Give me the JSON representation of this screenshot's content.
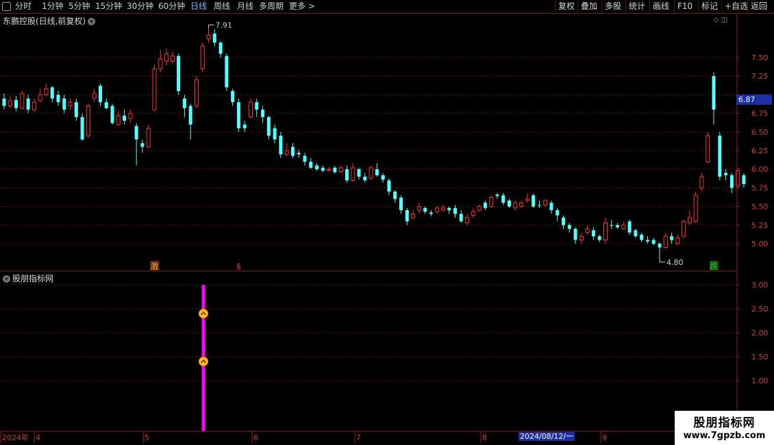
{
  "toolbar": {
    "periods": [
      "分时",
      "1分钟",
      "5分钟",
      "15分钟",
      "30分钟",
      "60分钟",
      "日线",
      "周线",
      "月线",
      "多周期",
      "更多 >"
    ],
    "active_period": "日线",
    "buttons": [
      "复权",
      "叠加",
      "多股",
      "统计",
      "画线",
      "F10",
      "标记",
      "+自选",
      "返回"
    ]
  },
  "main_chart": {
    "title": "东鹏控股(日线,前复权)",
    "current_price_label": "6.87",
    "high_marker": "7.91",
    "low_marker": "4.80",
    "signal_labels": [
      {
        "text": "激",
        "color": "#f0a030"
      },
      {
        "text": "$",
        "color": "#e03030"
      },
      {
        "text": "跌",
        "color": "#30c030"
      }
    ]
  },
  "indicator": {
    "title": "股朋指标网"
  },
  "date_axis": {
    "labels": [
      "2024年",
      "4",
      "5",
      "6",
      "7",
      "8",
      "9"
    ],
    "cursor_date": "2024/08/12/一"
  },
  "watermark": {
    "title": "股朋指标网",
    "url": "www.7gpzb.com"
  },
  "colors": {
    "up": "#ff3333",
    "down": "#54ffff",
    "grid": "#7a1010",
    "signal": "#ff00ff",
    "marker": "#ffc020"
  },
  "chart_data": [
    {
      "type": "candlestick",
      "title": "东鹏控股(日线,前复权)",
      "yticks": [
        5.0,
        5.25,
        5.5,
        5.75,
        6.0,
        6.25,
        6.5,
        6.75,
        7.0,
        7.25,
        7.5
      ],
      "ylim": [
        4.7,
        8.0
      ],
      "dir": "1=rise(hollow red), 0=fall(filled cyan)",
      "candles": [
        [
          6.95,
          6.85,
          7.02,
          6.8,
          0
        ],
        [
          6.85,
          6.92,
          6.98,
          6.82,
          1
        ],
        [
          6.93,
          6.82,
          6.98,
          6.78,
          0
        ],
        [
          6.82,
          7.02,
          7.05,
          6.8,
          1
        ],
        [
          6.95,
          6.8,
          7.0,
          6.75,
          0
        ],
        [
          6.8,
          6.9,
          6.95,
          6.76,
          1
        ],
        [
          6.92,
          7.0,
          7.08,
          6.9,
          1
        ],
        [
          7.0,
          7.08,
          7.15,
          6.98,
          1
        ],
        [
          7.1,
          6.95,
          7.12,
          6.9,
          0
        ],
        [
          7.0,
          6.9,
          7.05,
          6.85,
          0
        ],
        [
          6.95,
          6.8,
          7.0,
          6.75,
          0
        ],
        [
          6.85,
          6.9,
          6.95,
          6.8,
          1
        ],
        [
          6.9,
          6.7,
          6.95,
          6.65,
          0
        ],
        [
          6.7,
          6.4,
          6.75,
          6.38,
          0
        ],
        [
          6.45,
          6.85,
          6.88,
          6.42,
          1
        ],
        [
          6.95,
          7.02,
          7.08,
          6.9,
          1
        ],
        [
          7.12,
          6.9,
          7.15,
          6.85,
          0
        ],
        [
          6.9,
          6.82,
          6.95,
          6.8,
          0
        ],
        [
          6.85,
          6.62,
          6.88,
          6.6,
          0
        ],
        [
          6.6,
          6.72,
          6.78,
          6.58,
          1
        ],
        [
          6.72,
          6.65,
          6.8,
          6.6,
          0
        ],
        [
          6.68,
          6.75,
          6.8,
          6.62,
          1
        ],
        [
          6.58,
          6.4,
          6.62,
          6.05,
          0
        ],
        [
          6.35,
          6.3,
          6.4,
          6.22,
          0
        ],
        [
          6.3,
          6.55,
          6.6,
          6.28,
          1
        ],
        [
          6.8,
          7.35,
          7.4,
          6.78,
          1
        ],
        [
          7.35,
          7.48,
          7.6,
          7.3,
          1
        ],
        [
          7.45,
          7.55,
          7.62,
          7.4,
          1
        ],
        [
          7.45,
          7.52,
          7.58,
          7.42,
          1
        ],
        [
          7.52,
          7.05,
          7.55,
          7.0,
          0
        ],
        [
          6.95,
          6.82,
          7.0,
          6.7,
          0
        ],
        [
          6.85,
          6.6,
          6.88,
          6.4,
          0
        ],
        [
          6.85,
          7.2,
          7.25,
          6.82,
          1
        ],
        [
          7.35,
          7.65,
          7.7,
          7.3,
          1
        ],
        [
          7.75,
          7.8,
          7.91,
          7.7,
          1
        ],
        [
          7.82,
          7.7,
          7.88,
          7.65,
          0
        ],
        [
          7.7,
          7.55,
          7.72,
          7.5,
          0
        ],
        [
          7.52,
          7.1,
          7.55,
          7.05,
          0
        ],
        [
          7.05,
          6.9,
          7.08,
          6.85,
          0
        ],
        [
          6.9,
          6.55,
          6.95,
          6.5,
          0
        ],
        [
          6.6,
          6.55,
          6.65,
          6.5,
          0
        ],
        [
          6.7,
          6.9,
          6.95,
          6.68,
          1
        ],
        [
          6.9,
          6.8,
          6.95,
          6.7,
          0
        ],
        [
          6.8,
          6.7,
          6.85,
          6.62,
          0
        ],
        [
          6.7,
          6.45,
          6.72,
          6.4,
          0
        ],
        [
          6.55,
          6.4,
          6.6,
          6.35,
          0
        ],
        [
          6.45,
          6.2,
          6.5,
          6.15,
          0
        ],
        [
          6.2,
          6.25,
          6.35,
          6.18,
          1
        ],
        [
          6.3,
          6.18,
          6.35,
          6.15,
          0
        ],
        [
          6.22,
          6.2,
          6.26,
          6.15,
          0
        ],
        [
          6.18,
          6.1,
          6.22,
          6.05,
          0
        ],
        [
          6.1,
          6.02,
          6.15,
          6.0,
          0
        ],
        [
          6.05,
          6.0,
          6.08,
          5.98,
          0
        ],
        [
          6.02,
          5.98,
          6.05,
          5.96,
          0
        ],
        [
          5.99,
          6.0,
          6.03,
          5.96,
          1
        ],
        [
          6.02,
          5.96,
          6.05,
          5.94,
          0
        ],
        [
          5.97,
          6.02,
          6.05,
          5.95,
          1
        ],
        [
          6.0,
          5.85,
          6.05,
          5.82,
          0
        ],
        [
          5.85,
          6.02,
          6.08,
          5.83,
          1
        ],
        [
          6.0,
          5.9,
          6.02,
          5.86,
          0
        ],
        [
          5.9,
          5.85,
          5.95,
          5.82,
          0
        ],
        [
          5.88,
          6.02,
          6.05,
          5.86,
          1
        ],
        [
          6.0,
          5.92,
          6.08,
          5.9,
          0
        ],
        [
          5.92,
          5.86,
          5.95,
          5.82,
          0
        ],
        [
          5.85,
          5.7,
          5.88,
          5.65,
          0
        ],
        [
          5.7,
          5.6,
          5.72,
          5.55,
          0
        ],
        [
          5.62,
          5.45,
          5.65,
          5.4,
          0
        ],
        [
          5.45,
          5.3,
          5.48,
          5.25,
          0
        ],
        [
          5.35,
          5.4,
          5.45,
          5.32,
          1
        ],
        [
          5.45,
          5.5,
          5.55,
          5.4,
          1
        ],
        [
          5.48,
          5.43,
          5.5,
          5.4,
          0
        ],
        [
          5.42,
          5.4,
          5.45,
          5.37,
          0
        ],
        [
          5.43,
          5.48,
          5.5,
          5.4,
          1
        ],
        [
          5.45,
          5.48,
          5.52,
          5.43,
          1
        ],
        [
          5.48,
          5.45,
          5.5,
          5.4,
          0
        ],
        [
          5.48,
          5.4,
          5.52,
          5.35,
          0
        ],
        [
          5.4,
          5.3,
          5.45,
          5.28,
          0
        ],
        [
          5.28,
          5.35,
          5.4,
          5.25,
          1
        ],
        [
          5.38,
          5.43,
          5.48,
          5.35,
          1
        ],
        [
          5.45,
          5.5,
          5.52,
          5.43,
          1
        ],
        [
          5.55,
          5.48,
          5.58,
          5.45,
          0
        ],
        [
          5.5,
          5.62,
          5.65,
          5.48,
          1
        ],
        [
          5.66,
          5.64,
          5.68,
          5.6,
          0
        ],
        [
          5.65,
          5.55,
          5.68,
          5.52,
          0
        ],
        [
          5.58,
          5.5,
          5.6,
          5.48,
          0
        ],
        [
          5.48,
          5.55,
          5.58,
          5.45,
          1
        ],
        [
          5.5,
          5.55,
          5.58,
          5.48,
          1
        ],
        [
          5.58,
          5.6,
          5.68,
          5.55,
          1
        ],
        [
          5.65,
          5.5,
          5.67,
          5.48,
          0
        ],
        [
          5.52,
          5.52,
          5.58,
          5.48,
          0
        ],
        [
          5.52,
          5.58,
          5.6,
          5.5,
          1
        ],
        [
          5.55,
          5.45,
          5.58,
          5.4,
          0
        ],
        [
          5.45,
          5.38,
          5.48,
          5.3,
          0
        ],
        [
          5.35,
          5.25,
          5.38,
          5.2,
          0
        ],
        [
          5.25,
          5.2,
          5.28,
          5.15,
          0
        ],
        [
          5.2,
          5.05,
          5.22,
          5.0,
          0
        ],
        [
          5.05,
          5.1,
          5.15,
          5.0,
          1
        ],
        [
          5.15,
          5.2,
          5.25,
          5.12,
          1
        ],
        [
          5.18,
          5.1,
          5.22,
          5.05,
          0
        ],
        [
          5.1,
          5.05,
          5.12,
          5.02,
          0
        ],
        [
          5.05,
          5.28,
          5.35,
          5.0,
          1
        ],
        [
          5.25,
          5.25,
          5.32,
          5.2,
          0
        ],
        [
          5.25,
          5.22,
          5.28,
          5.2,
          0
        ],
        [
          5.2,
          5.25,
          5.3,
          5.18,
          1
        ],
        [
          5.3,
          5.15,
          5.32,
          5.12,
          0
        ],
        [
          5.18,
          5.1,
          5.2,
          5.08,
          0
        ],
        [
          5.12,
          5.05,
          5.15,
          5.02,
          0
        ],
        [
          5.05,
          5.03,
          5.1,
          5.0,
          0
        ],
        [
          5.05,
          5.0,
          5.08,
          4.98,
          0
        ],
        [
          5.0,
          4.95,
          5.02,
          4.8,
          0
        ],
        [
          4.95,
          5.1,
          5.15,
          4.93,
          1
        ],
        [
          5.1,
          5.05,
          5.15,
          5.0,
          0
        ],
        [
          5.0,
          5.08,
          5.12,
          4.98,
          1
        ],
        [
          5.1,
          5.3,
          5.32,
          5.08,
          1
        ],
        [
          5.28,
          5.35,
          5.45,
          5.25,
          1
        ],
        [
          5.3,
          5.65,
          5.7,
          5.28,
          1
        ],
        [
          5.75,
          5.9,
          5.95,
          5.7,
          1
        ],
        [
          6.1,
          6.45,
          6.5,
          6.08,
          1
        ],
        [
          6.8,
          7.25,
          7.3,
          6.6,
          0
        ],
        [
          6.45,
          5.9,
          6.5,
          5.85,
          0
        ],
        [
          5.95,
          5.92,
          6.0,
          5.85,
          0
        ],
        [
          5.92,
          5.75,
          5.95,
          5.68,
          0
        ],
        [
          5.78,
          5.98,
          6.02,
          5.75,
          1
        ],
        [
          5.92,
          5.8,
          5.95,
          5.75,
          0
        ]
      ]
    },
    {
      "type": "bar",
      "title": "股朋指标网",
      "yticks": [
        1.0,
        1.5,
        2.0,
        2.5,
        3.0
      ],
      "ylim": [
        0.35,
        3.15
      ],
      "signal_candle_index": 34,
      "signal_top": 3.0,
      "markers": [
        2.4,
        1.4
      ]
    }
  ]
}
